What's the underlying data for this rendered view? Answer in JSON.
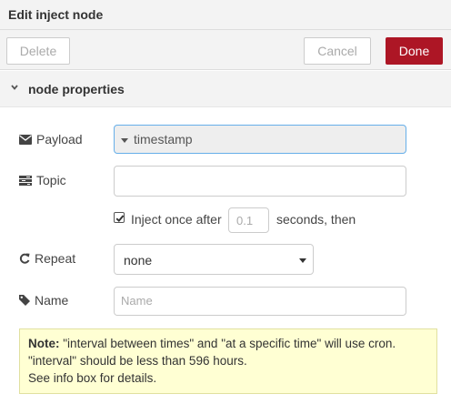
{
  "window": {
    "title": "Edit inject node"
  },
  "toolbar": {
    "delete_label": "Delete",
    "cancel_label": "Cancel",
    "done_label": "Done"
  },
  "section": {
    "label": "node properties",
    "icon": "chevron-down-icon"
  },
  "form": {
    "payload": {
      "label": "Payload",
      "icon": "envelope-icon",
      "value": "timestamp"
    },
    "topic": {
      "label": "Topic",
      "icon": "tasks-icon",
      "value": ""
    },
    "once": {
      "checked": true,
      "label": "Inject once after",
      "value": "0.1",
      "suffix": "seconds, then"
    },
    "repeat": {
      "label": "Repeat",
      "icon": "refresh-icon",
      "value": "none"
    },
    "name": {
      "label": "Name",
      "icon": "tag-icon",
      "placeholder": "Name"
    }
  },
  "note": {
    "bold": "Note:",
    "line1": "\"interval between times\" and \"at a specific time\" will use cron.",
    "line2": "\"interval\" should be less than 596 hours.",
    "line3": "See info box for details."
  },
  "colors": {
    "accent_done": "#ad1625",
    "note_bg": "#ffffd3",
    "focus_border": "#66afe9"
  }
}
